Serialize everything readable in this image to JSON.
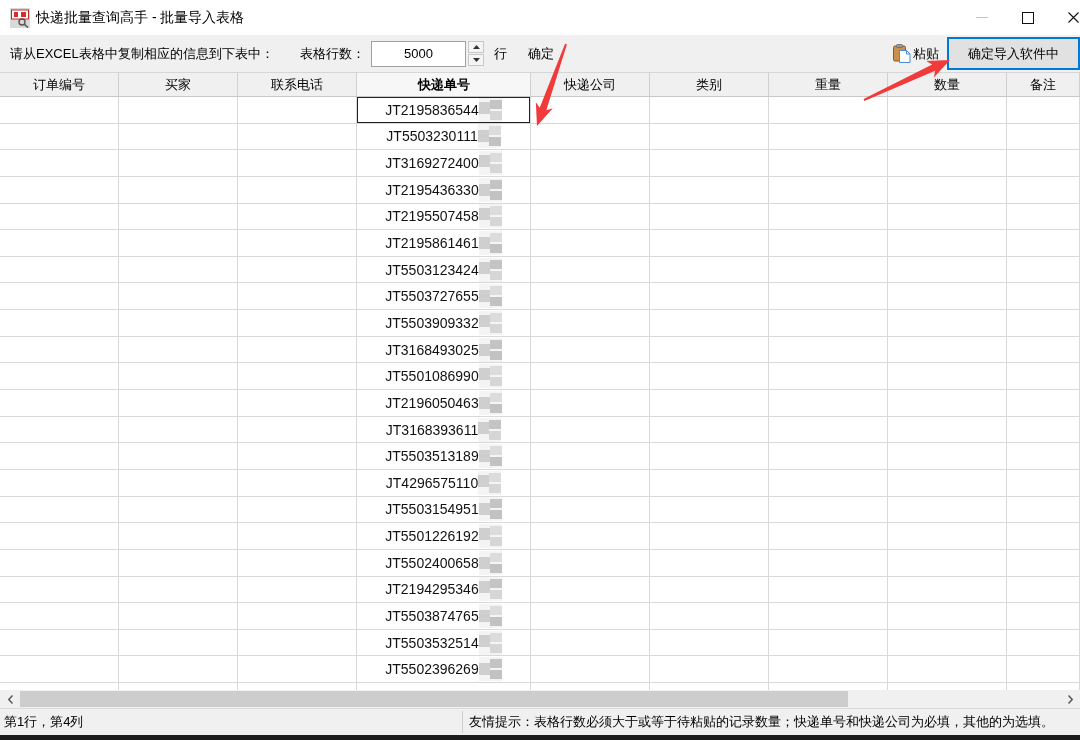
{
  "window": {
    "title": "快递批量查询高手 - 批量导入表格",
    "controls": [
      {
        "kind": "minimize",
        "disabled": true
      },
      {
        "kind": "maximize",
        "disabled": false
      },
      {
        "kind": "close",
        "disabled": false
      }
    ]
  },
  "toolbar": {
    "instruction": "请从EXCEL表格中复制相应的信息到下表中：",
    "rows_label": "表格行数：",
    "rows_value": "5000",
    "rows_unit": "行",
    "confirm": "确定",
    "paste": "粘贴",
    "import_button": {
      "label": "确定导入软件中",
      "focused": true
    }
  },
  "table": {
    "columns": [
      {
        "label": "订单编号",
        "kind": "text",
        "selected": false
      },
      {
        "label": "买家",
        "kind": "text",
        "selected": false
      },
      {
        "label": "联系电话",
        "kind": "text",
        "selected": false
      },
      {
        "label": "快递单号",
        "kind": "tracking",
        "selected": true
      },
      {
        "label": "快递公司",
        "kind": "text",
        "selected": false
      },
      {
        "label": "类别",
        "kind": "text",
        "selected": false
      },
      {
        "label": "重量",
        "kind": "text",
        "selected": false
      },
      {
        "label": "数量",
        "kind": "text",
        "selected": false
      },
      {
        "label": "备注",
        "kind": "text",
        "selected": false
      }
    ],
    "rows": [
      {
        "tracking_no": "JT2195836544",
        "selected": true
      },
      {
        "tracking_no": "JT5503230111",
        "selected": false
      },
      {
        "tracking_no": "JT3169272400",
        "selected": false
      },
      {
        "tracking_no": "JT2195436330",
        "selected": false
      },
      {
        "tracking_no": "JT2195507458",
        "selected": false
      },
      {
        "tracking_no": "JT2195861461",
        "selected": false
      },
      {
        "tracking_no": "JT5503123424",
        "selected": false
      },
      {
        "tracking_no": "JT5503727655",
        "selected": false
      },
      {
        "tracking_no": "JT5503909332",
        "selected": false
      },
      {
        "tracking_no": "JT3168493025",
        "selected": false
      },
      {
        "tracking_no": "JT5501086990",
        "selected": false
      },
      {
        "tracking_no": "JT2196050463",
        "selected": false
      },
      {
        "tracking_no": "JT3168393611",
        "selected": false
      },
      {
        "tracking_no": "JT5503513189",
        "selected": false
      },
      {
        "tracking_no": "JT4296575110",
        "selected": false
      },
      {
        "tracking_no": "JT5503154951",
        "selected": false
      },
      {
        "tracking_no": "JT5501226192",
        "selected": false
      },
      {
        "tracking_no": "JT5502400658",
        "selected": false
      },
      {
        "tracking_no": "JT2194295346",
        "selected": false
      },
      {
        "tracking_no": "JT5503874765",
        "selected": false
      },
      {
        "tracking_no": "JT5503532514",
        "selected": false
      },
      {
        "tracking_no": "JT5502396269",
        "selected": false
      }
    ]
  },
  "status_bar": {
    "position": "第1行，第4列",
    "hint": "友情提示：表格行数必须大于或等于待粘贴的记录数量；快递单号和快递公司为必填，其他的为选填。"
  }
}
